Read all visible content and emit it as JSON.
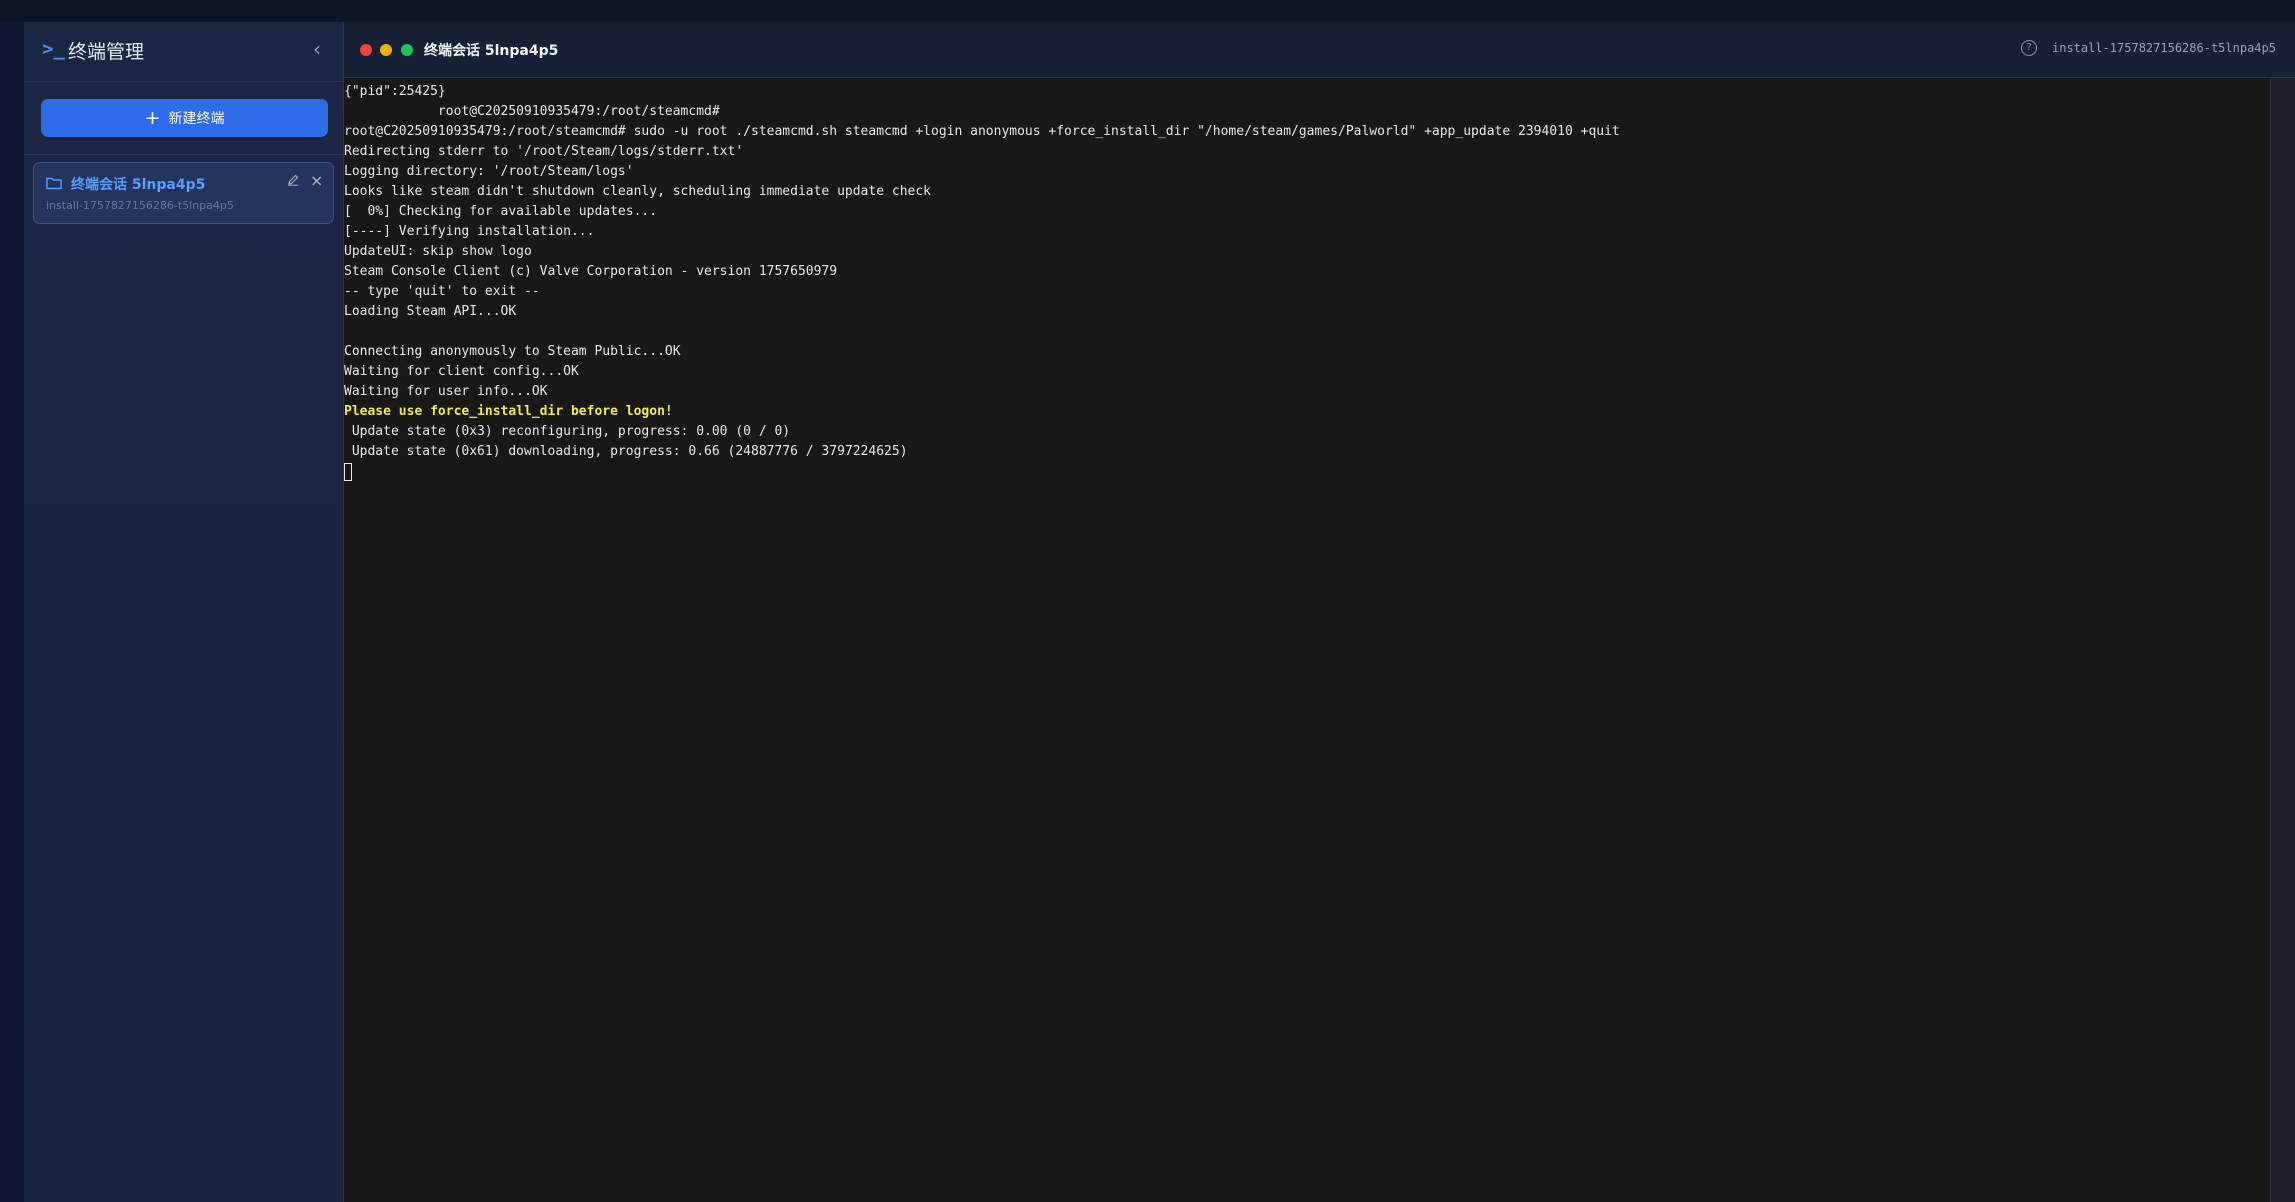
{
  "sidebar": {
    "logo": ">_",
    "title": "终端管理",
    "collapse_icon": "‹",
    "new_terminal_label": "新建终端",
    "sessions": [
      {
        "name": "终端会话 5lnpa4p5",
        "id": "install-1757827156286-t5lnpa4p5"
      }
    ]
  },
  "terminal": {
    "title": "终端会话 5lnpa4p5",
    "session_id": "install-1757827156286-t5lnpa4p5",
    "lines": [
      "{\"pid\":25425}",
      "            root@C20250910935479:/root/steamcmd#",
      "root@C20250910935479:/root/steamcmd# sudo -u root ./steamcmd.sh steamcmd +login anonymous +force_install_dir \"/home/steam/games/Palworld\" +app_update 2394010 +quit",
      "Redirecting stderr to '/root/Steam/logs/stderr.txt'",
      "Logging directory: '/root/Steam/logs'",
      "Looks like steam didn't shutdown cleanly, scheduling immediate update check",
      "[  0%] Checking for available updates...",
      "[----] Verifying installation...",
      "UpdateUI: skip show logo",
      "Steam Console Client (c) Valve Corporation - version 1757650979",
      "-- type 'quit' to exit --",
      "Loading Steam API...OK",
      "",
      "Connecting anonymously to Steam Public...OK",
      "Waiting for client config...OK",
      "Waiting for user info...OK",
      "Please use force_install_dir before logon!",
      " Update state (0x3) reconfiguring, progress: 0.00 (0 / 0)",
      " Update state (0x61) downloading, progress: 0.66 (24887776 / 3797224625)"
    ]
  },
  "colors": {
    "accent": "#2e6be6",
    "warning_text": "#f5e84a",
    "window_close": "#ef4444",
    "window_minimize": "#eab308",
    "window_maximize": "#22c55e"
  }
}
